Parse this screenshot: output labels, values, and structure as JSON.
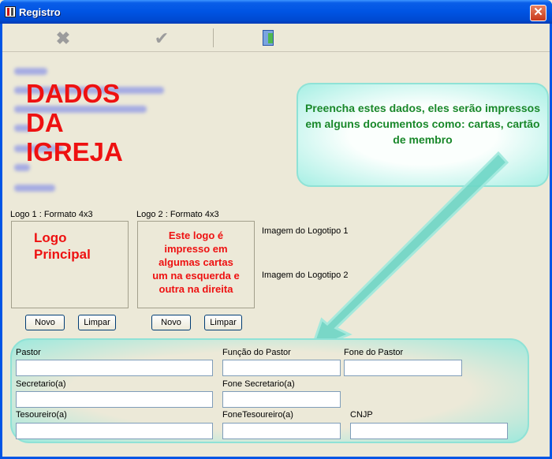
{
  "window": {
    "title": "Registro",
    "close_label": "✕"
  },
  "toolbar": {
    "cancel_icon": "x-cancel-icon",
    "confirm_icon": "checkmark-icon",
    "exit_icon": "door-exit-icon"
  },
  "overlay": {
    "big_red_text": [
      "DADOS",
      "DA",
      "IGREJA"
    ],
    "callout_text": "Preencha estes dados, eles serão impressos em alguns documentos como: cartas, cartão de membro"
  },
  "logos": {
    "logo1_label": "Logo 1 : Formato 4x3",
    "logo2_label": "Logo 2 : Formato 4x3",
    "logo1_text": [
      "Logo",
      "Principal"
    ],
    "logo2_text": [
      "Este logo é",
      "impresso em",
      "algumas cartas",
      "um na esquerda e",
      "outra na direita"
    ],
    "image_label_1": "Imagem do Logotipo 1",
    "image_label_2": "Imagem do Logotipo 2",
    "new_label": "Novo",
    "clear_label": "Limpar"
  },
  "form": {
    "pastor_label": "Pastor",
    "pastor_function_label": "Função do Pastor",
    "pastor_phone_label": "Fone do Pastor",
    "secretary_label": "Secretario(a)",
    "secretary_phone_label": "Fone Secretario(a)",
    "treasurer_label": "Tesoureiro(a)",
    "treasurer_phone_label": "FoneTesoureiro(a)",
    "cnpj_label": "CNJP",
    "pastor_value": "",
    "pastor_function_value": "",
    "pastor_phone_value": "",
    "secretary_value": "",
    "secretary_phone_value": "",
    "treasurer_value": "",
    "treasurer_phone_value": "",
    "cnpj_value": ""
  },
  "colors": {
    "red_text": "#ee1111",
    "green_text": "#19882a",
    "callout_border": "#8fe2d6",
    "titlebar_blue": "#0054e3"
  }
}
